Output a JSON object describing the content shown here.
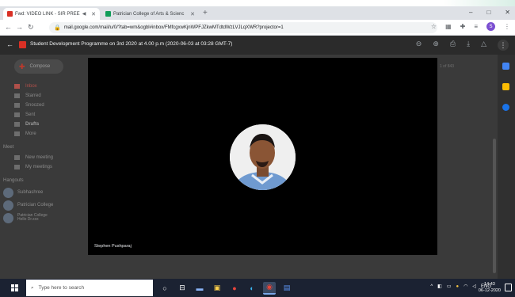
{
  "browser": {
    "tabs": [
      {
        "label": "Fwd: VIDEO LINK - SIR PREE",
        "favicon_color": "#d93025",
        "extra": "◀"
      },
      {
        "label": "Patrician College of Arts & Scienc",
        "favicon_color": "#0f9d58"
      }
    ],
    "new_tab": "+",
    "window_controls": [
      "–",
      "□",
      "✕"
    ],
    "url": "mail.google.com/mail/u/0/?tab=wm&ogbl#inbox/FMfcgxwKjnWPFJZkwMTdtdWzLVJLqXWR?projector=1",
    "profile_initial": "S"
  },
  "gmail": {
    "meeting_title": "Student Development Programme on 3rd 2020 at 4.00 p.m (2020-06-03 at 03:28 GMT-7)",
    "compose_label": "Compose",
    "folders": [
      "Inbox",
      "Starred",
      "Snoozed",
      "Sent",
      "Drafts",
      "More"
    ],
    "meet_section": "Meet",
    "meet_items": [
      "New meeting",
      "My meetings"
    ],
    "hangouts_section": "Hangouts",
    "hangouts": [
      "Subhashree",
      "Patrician College",
      "Patrician College",
      "Hello Dr.xxx"
    ],
    "right_text": "1 of 843",
    "accent_colors": {
      "inbox": "#b0504a",
      "apps": [
        "#4285f4",
        "#fbbc04",
        "#1a73e8"
      ]
    }
  },
  "video": {
    "speaker_name": "Stephen Pushparaj"
  },
  "taskbar": {
    "search_placeholder": "Type here to search",
    "tray_lang": "ENG",
    "time": "14:43",
    "date": "06-12-2020"
  }
}
